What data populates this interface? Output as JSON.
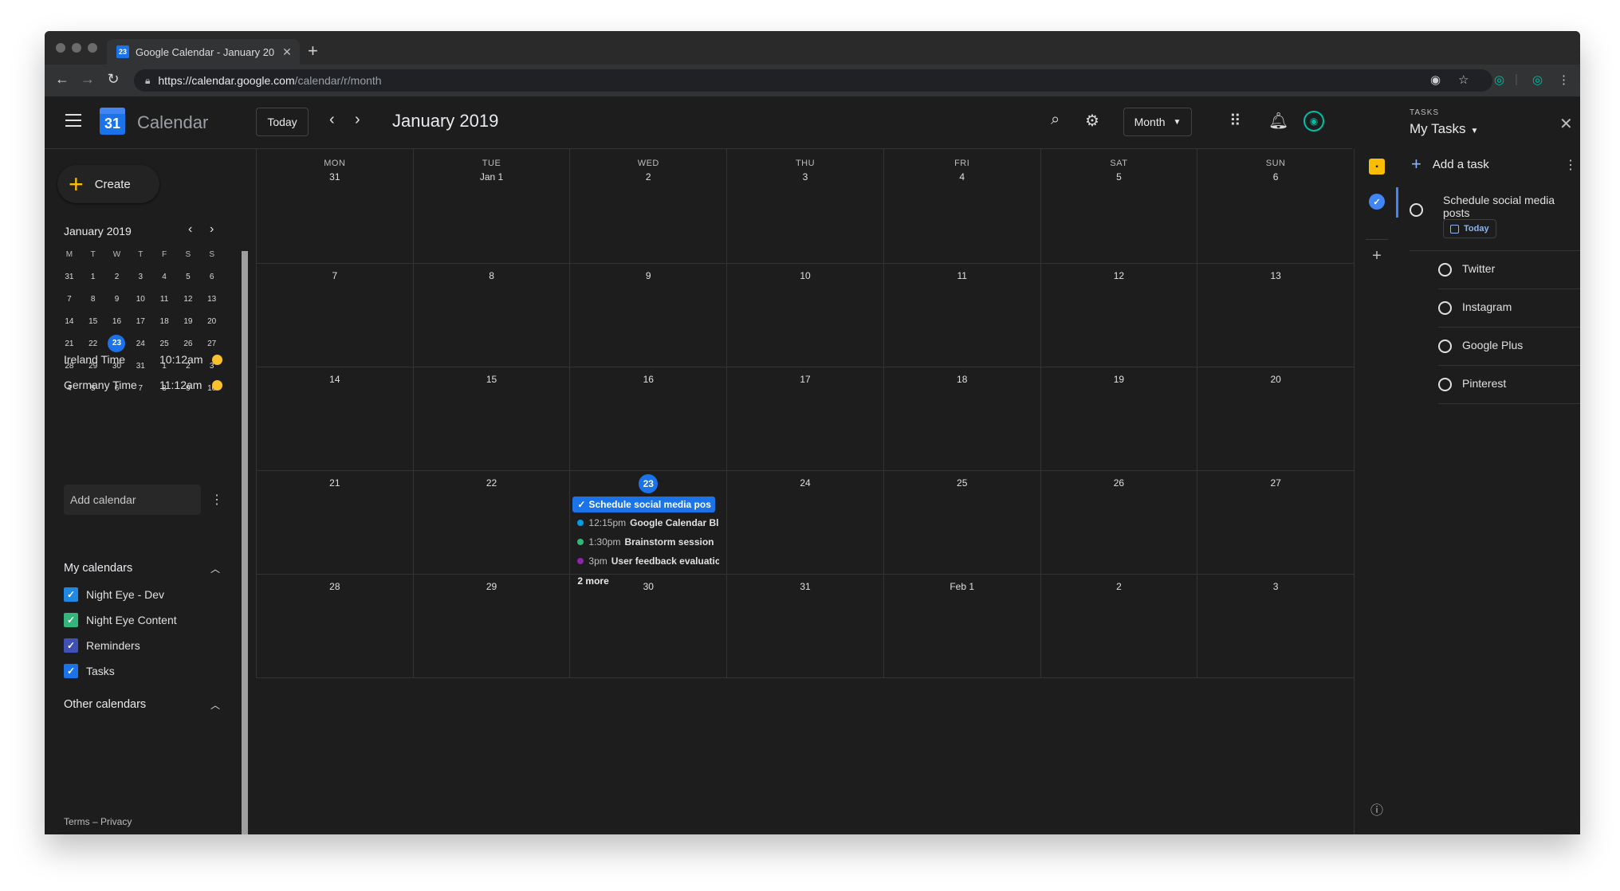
{
  "browser": {
    "tab_title": "Google Calendar - January 20",
    "tab_favicon_text": "23",
    "url_host": "https://calendar.google.com",
    "url_path": "/calendar/r/month"
  },
  "header": {
    "app_name": "Calendar",
    "logo_text": "31",
    "today_label": "Today",
    "month_title": "January 2019",
    "view_label": "Month"
  },
  "sidebar": {
    "create_label": "Create",
    "mini_month": "January 2019",
    "mini_weekdays": [
      "M",
      "T",
      "W",
      "T",
      "F",
      "S",
      "S"
    ],
    "mini_weeks": [
      [
        "31",
        "1",
        "2",
        "3",
        "4",
        "5",
        "6"
      ],
      [
        "7",
        "8",
        "9",
        "10",
        "11",
        "12",
        "13"
      ],
      [
        "14",
        "15",
        "16",
        "17",
        "18",
        "19",
        "20"
      ],
      [
        "21",
        "22",
        "23",
        "24",
        "25",
        "26",
        "27"
      ],
      [
        "28",
        "29",
        "30",
        "31",
        "1",
        "2",
        "3"
      ],
      [
        "4",
        "5",
        "6",
        "7",
        "8",
        "9",
        "10"
      ]
    ],
    "selected_day": "23",
    "timezones": [
      {
        "label": "Ireland Time",
        "time": "10:12am"
      },
      {
        "label": "Germany Time",
        "time": "11:12am"
      }
    ],
    "add_calendar_placeholder": "Add calendar",
    "my_calendars_label": "My calendars",
    "my_calendars": [
      {
        "label": "Night Eye - Dev",
        "color": "#1e88e5"
      },
      {
        "label": "Night Eye Content",
        "color": "#33b679"
      },
      {
        "label": "Reminders",
        "color": "#3f51b5"
      },
      {
        "label": "Tasks",
        "color": "#1a73e8"
      }
    ],
    "other_calendars_label": "Other calendars",
    "footer": "Terms – Privacy"
  },
  "grid": {
    "weekdays": [
      "MON",
      "TUE",
      "WED",
      "THU",
      "FRI",
      "SAT",
      "SUN"
    ],
    "weeks": [
      [
        "31",
        "Jan 1",
        "2",
        "3",
        "4",
        "5",
        "6"
      ],
      [
        "7",
        "8",
        "9",
        "10",
        "11",
        "12",
        "13"
      ],
      [
        "14",
        "15",
        "16",
        "17",
        "18",
        "19",
        "20"
      ],
      [
        "21",
        "22",
        "23",
        "24",
        "25",
        "26",
        "27"
      ],
      [
        "28",
        "29",
        "30",
        "31",
        "Feb 1",
        "2",
        "3"
      ]
    ],
    "today": "23",
    "events_23": {
      "task_chip": "Schedule social media pos",
      "items": [
        {
          "time": "12:15pm",
          "title": "Google Calendar Bl",
          "color": "#039be5"
        },
        {
          "time": "1:30pm",
          "title": "Brainstorm session",
          "color": "#33b679"
        },
        {
          "time": "3pm",
          "title": "User feedback evaluatic",
          "color": "#8e24aa"
        }
      ],
      "more": "2 more"
    }
  },
  "tasks": {
    "label": "TASKS",
    "list_name": "My Tasks",
    "add_label": "Add a task",
    "main_task": "Schedule social media posts",
    "due_label": "Today",
    "subtasks": [
      "Twitter",
      "Instagram",
      "Google Plus",
      "Pinterest"
    ]
  },
  "colors": {
    "accent": "#1a73e8",
    "background": "#1d1d1d",
    "keep": "#fbbc04"
  }
}
